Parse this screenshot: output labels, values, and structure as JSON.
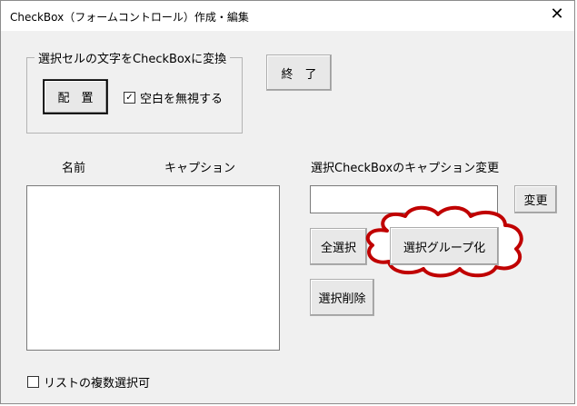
{
  "window": {
    "title": "CheckBox（フォームコントロール）作成・編集",
    "close_glyph": "✕"
  },
  "frame": {
    "legend": "選択セルの文字をCheckBoxに変換",
    "place_button": "配　置",
    "ignore_blank": {
      "label": "空白を無視する",
      "checked": true,
      "mark": "✓"
    }
  },
  "end_button": "終　了",
  "list": {
    "header_name": "名前",
    "header_caption": "キャプション",
    "multi_select": {
      "label": "リストの複数選択可",
      "checked": false
    }
  },
  "caption_edit": {
    "label": "選択CheckBoxのキャプション変更",
    "value": "",
    "change_button": "変更"
  },
  "buttons": {
    "select_all": "全選択",
    "group": "選択グループ化",
    "delete_selected": "選択削除"
  },
  "colors": {
    "callout_cloud": "#c00000",
    "window_bg": "#f0f0f0"
  }
}
